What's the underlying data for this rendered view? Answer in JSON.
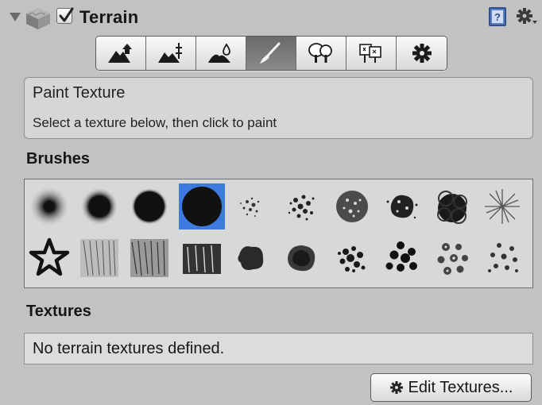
{
  "header": {
    "title": "Terrain",
    "enabled": true,
    "icons": [
      "foldout-arrow-icon",
      "terrain-cube-icon",
      "help-book-icon",
      "gear-menu-icon"
    ]
  },
  "toolbar": {
    "tools": [
      {
        "name": "raise-lower-terrain-icon"
      },
      {
        "name": "set-height-icon"
      },
      {
        "name": "smooth-height-icon"
      },
      {
        "name": "paint-texture-brush-icon",
        "active": true
      },
      {
        "name": "place-trees-icon"
      },
      {
        "name": "paint-details-icon"
      },
      {
        "name": "terrain-settings-gear-icon"
      }
    ]
  },
  "info": {
    "title": "Paint Texture",
    "description": "Select a texture below, then click to paint"
  },
  "brushes": {
    "label": "Brushes",
    "selected_index": 3,
    "count": 20,
    "selection_color": "#3d7be1"
  },
  "textures": {
    "label": "Textures",
    "empty_message": "No terrain textures defined."
  },
  "edit_textures_button": {
    "label": "Edit Textures..."
  }
}
